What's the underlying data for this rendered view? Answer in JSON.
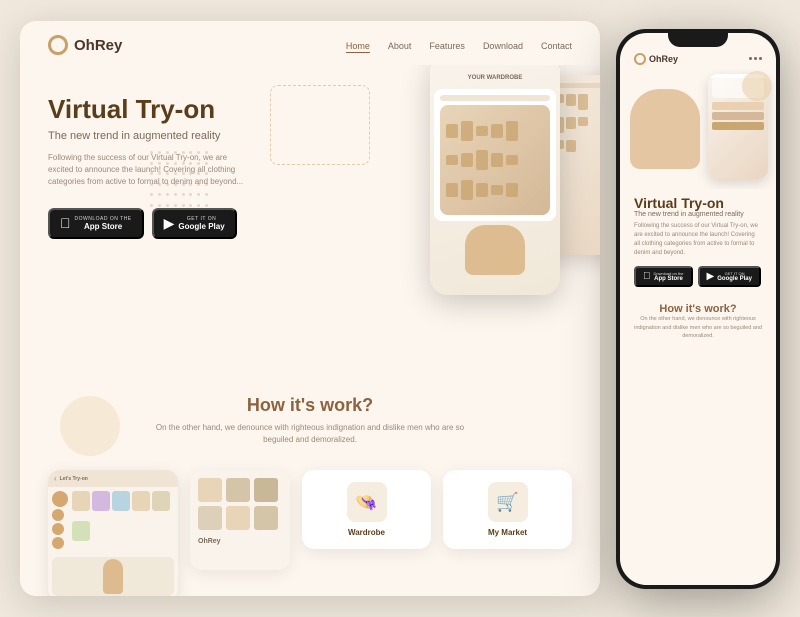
{
  "desktop": {
    "logo": "OhRey",
    "nav": {
      "links": [
        "Home",
        "About",
        "Features",
        "Download",
        "Contact"
      ],
      "active": "Home"
    },
    "hero": {
      "title": "Virtual Try-on",
      "subtitle": "The new trend in augmented reality",
      "description": "Following the success of our Virtual Try-on, we are excited to announce the launch! Covering all clothing categories from active to formal to denim and beyond...",
      "btn_appstore": "App Store",
      "btn_appstore_small": "Download on the",
      "btn_google": "Google Play",
      "btn_google_small": "GET IT ON"
    },
    "how": {
      "title": "How it's work?",
      "description": "On the other hand, we denounce with righteous indignation and dislike men who are so beguiled and demoralized."
    },
    "features": {
      "card1_label": "Wardrobe",
      "card2_label": "My Market",
      "phone_header": "Let's Try-on"
    }
  },
  "mobile": {
    "logo": "OhRey",
    "hero": {
      "title": "Virtual Try-on",
      "subtitle": "The new trend in augmented reality",
      "description": "Following the success of our Virtual Try-on, we are excited to announce the launch! Covering all clothing categories from active to formal to denim and beyond.",
      "btn_appstore": "App Store",
      "btn_appstore_small": "Download on the",
      "btn_google": "Google Play",
      "btn_google_small": "GET IT ON"
    },
    "how": {
      "title": "How it's work?",
      "description": "On the other hand, we denounce with righteous indignation and dislike men who are so beguiled and demoralized."
    }
  },
  "colors": {
    "accent": "#8b6340",
    "dark": "#5a3e1b",
    "light_bg": "#fdf6ee",
    "outer_bg": "#f0e8dc"
  }
}
